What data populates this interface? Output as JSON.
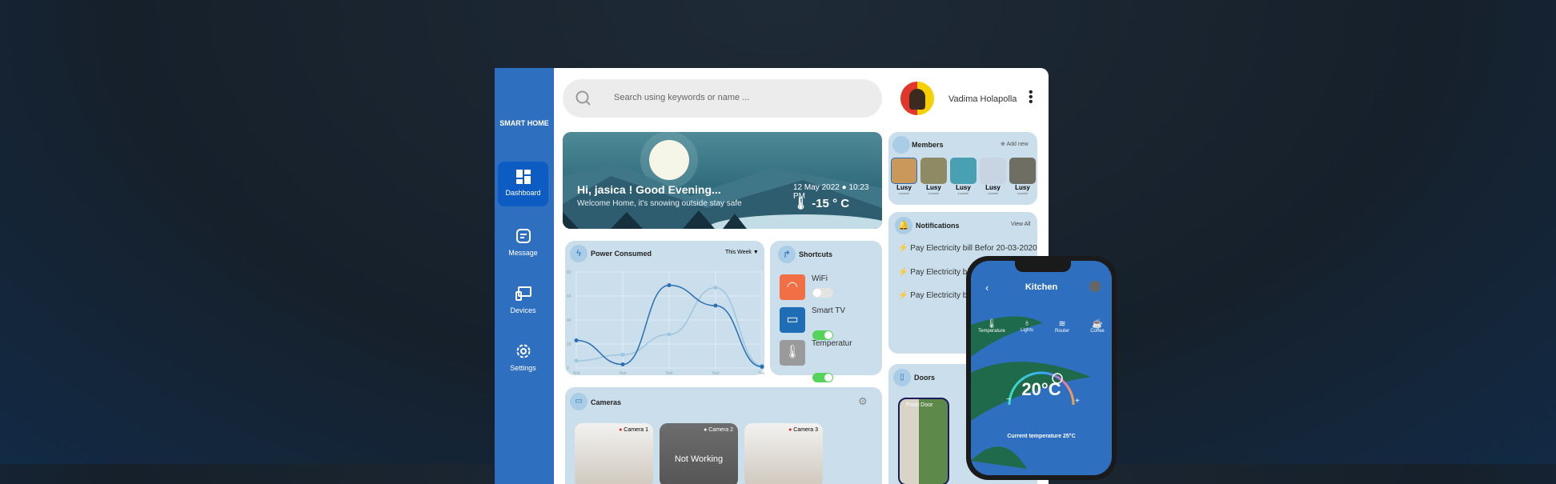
{
  "sidebar": {
    "brand": "SMART HOME",
    "items": [
      {
        "label": "Dashboard",
        "icon": "dashboard-icon"
      },
      {
        "label": "Message",
        "icon": "message-icon"
      },
      {
        "label": "Devices",
        "icon": "devices-icon"
      },
      {
        "label": "Settings",
        "icon": "gear-icon"
      }
    ]
  },
  "search": {
    "placeholder": "Search using keywords or name ..."
  },
  "user": {
    "name": "Vadima Holapolla"
  },
  "banner": {
    "greeting": "Hi, jasica ! Good Evening...",
    "subtitle": "Welcome Home, it's snowing outside stay safe",
    "date": "12 May 2022",
    "time": "10:23 PM",
    "temperature": "-15 ° C"
  },
  "members": {
    "title": "Members",
    "add": "Add new",
    "list": [
      {
        "name": "Lusy",
        "sub": "Locarlo"
      },
      {
        "name": "Lusy",
        "sub": "Locarlo"
      },
      {
        "name": "Lusy",
        "sub": "Locarlo"
      },
      {
        "name": "Lusy",
        "sub": "Locarlo"
      },
      {
        "name": "Lusy",
        "sub": "Locarlo"
      }
    ]
  },
  "notifications": {
    "title": "Notifications",
    "view_all": "View All",
    "items": [
      "Pay Electricity bill Befor 20-03-2020",
      "Pay Electricity bill Befor 20-03-2020",
      "Pay Electricity bill Befor 20-03-2020"
    ]
  },
  "power": {
    "title": "Power Consumed",
    "period": "This Week"
  },
  "chart_data": {
    "type": "line",
    "categories": [
      "Text",
      "Text",
      "Text",
      "Text",
      "Text"
    ],
    "ylim": [
      0,
      80
    ],
    "yticks": [
      0,
      20,
      40,
      60,
      80
    ],
    "grid": true,
    "series": [
      {
        "values": [
          23,
          3,
          69,
          52,
          1
        ],
        "color": "#2a6fb0"
      },
      {
        "values": [
          6,
          11,
          28,
          67,
          2
        ],
        "color": "#9fc6e0"
      }
    ]
  },
  "shortcuts": {
    "title": "Shortcuts",
    "items": [
      {
        "label": "WiFi",
        "on": false,
        "color": "#f26f45"
      },
      {
        "label": "Smart TV",
        "on": true,
        "color": "#1f6db5"
      },
      {
        "label": "Temperatur",
        "on": true,
        "color": "#9a9a9a"
      }
    ]
  },
  "cameras": {
    "title": "Cameras",
    "items": [
      {
        "label": "Camera 1",
        "status": "",
        "dot": "#e21b1b"
      },
      {
        "label": "Camera 2",
        "status": "Not Working",
        "dot": "#ffffff"
      },
      {
        "label": "Camera 3",
        "status": "",
        "dot": "#e21b1b"
      }
    ]
  },
  "doors": {
    "title": "Doors",
    "front": "Front Door"
  },
  "phone": {
    "title": "Kitchen",
    "devices": [
      "Temperature",
      "Lights",
      "Router",
      "Coffee"
    ],
    "setpoint": "20°C",
    "minus": "−",
    "plus": "+",
    "current": "Current temperature 25°C"
  }
}
